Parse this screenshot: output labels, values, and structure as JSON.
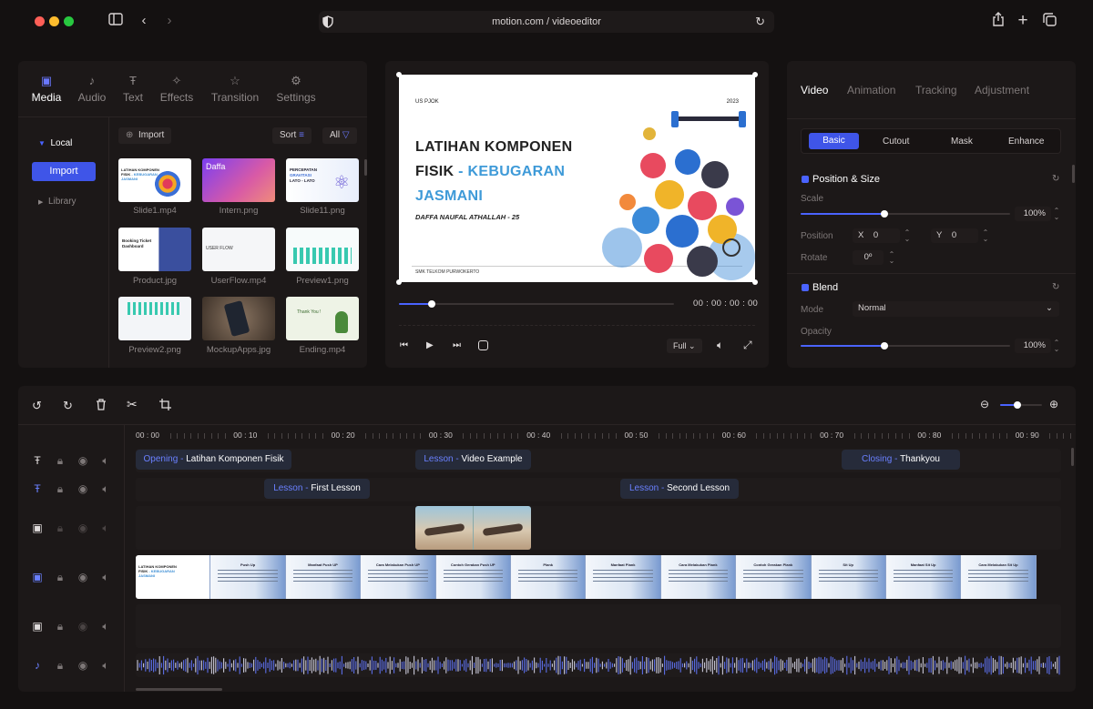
{
  "browser": {
    "url": "motion.com / videoeditor"
  },
  "left_tabs": [
    {
      "label": "Media",
      "icon": "media-icon"
    },
    {
      "label": "Audio",
      "icon": "music-note-icon"
    },
    {
      "label": "Text",
      "icon": "text-icon"
    },
    {
      "label": "Effects",
      "icon": "magic-wand-icon"
    },
    {
      "label": "Transition",
      "icon": "transition-icon"
    },
    {
      "label": "Settings",
      "icon": "sliders-icon"
    }
  ],
  "sidebar": {
    "local": "Local",
    "import_button": "Import",
    "library": "Library"
  },
  "media_toolbar": {
    "import": "Import",
    "sort": "Sort",
    "filter": "All"
  },
  "media_items": [
    "Slide1.mp4",
    "Intern.png",
    "Slide11.png",
    "Product.jpg",
    "UserFlow.mp4",
    "Preview1.png",
    "Preview2.png",
    "MockupApps.jpg",
    "Ending.mp4"
  ],
  "preview": {
    "tag": "US PJOK",
    "year": "2023",
    "title_line1": "LATIHAN KOMPONEN",
    "title_line2a": "FISIK",
    "title_line2b": " - KEBUGARAN",
    "title_line3": "JASMANI",
    "author": "DAFFA NAUFAL ATHALLAH - 25",
    "school": "SMK TELKOM PURWOKERTO",
    "timecode": "00 : 00 : 00 : 00",
    "progress": 0.12,
    "zoom_select": "Full"
  },
  "right_tabs": [
    "Video",
    "Animation",
    "Tracking",
    "Adjustment"
  ],
  "sub_tabs": [
    "Basic",
    "Cutout",
    "Mask",
    "Enhance"
  ],
  "position_size": {
    "title": "Position & Size",
    "scale_label": "Scale",
    "scale_value": "100%",
    "scale_fraction": 0.4,
    "position_label": "Position",
    "x_label": "X",
    "x_value": "0",
    "y_label": "Y",
    "y_value": "0",
    "rotate_label": "Rotate",
    "rotate_value": "0º"
  },
  "blend": {
    "title": "Blend",
    "mode_label": "Mode",
    "mode_value": "Normal",
    "opacity_label": "Opacity",
    "opacity_value": "100%",
    "opacity_fraction": 0.4
  },
  "timeline": {
    "ruler": [
      "00 : 00",
      "00 : 10",
      "00 : 20",
      "00 : 30",
      "00 : 40",
      "00 : 50",
      "00 : 60",
      "00 : 70",
      "00 : 80",
      "00 : 90"
    ],
    "text_track_1": [
      {
        "kind": "Opening",
        "sep": " - ",
        "name": "Latihan Komponen Fisik"
      },
      {
        "kind": "Lesson",
        "sep": " - ",
        "name": "Video Example"
      },
      {
        "kind": "Closing",
        "sep": " - ",
        "name": "Thankyou"
      }
    ],
    "text_track_2": [
      {
        "kind": "Lesson",
        "sep": " - ",
        "name": "First Lesson"
      },
      {
        "kind": "Lesson",
        "sep": " - ",
        "name": "Second Lesson"
      }
    ],
    "slide_titles": [
      "",
      "Push Up",
      "Manfaat Push UP",
      "Cara Melakukan Push UP",
      "Contoh Gerakan Push UP",
      "Plank",
      "Manfaat Plank",
      "Cara Melakukan Plank",
      "Contoh Gerakan Plank",
      "Sit Up",
      "Manfaat Sit Up",
      "Cara Melakukan Sit Up"
    ]
  },
  "colors": {
    "accent": "#3f55e8",
    "bg": "#141111",
    "panel": "#1c1818"
  }
}
